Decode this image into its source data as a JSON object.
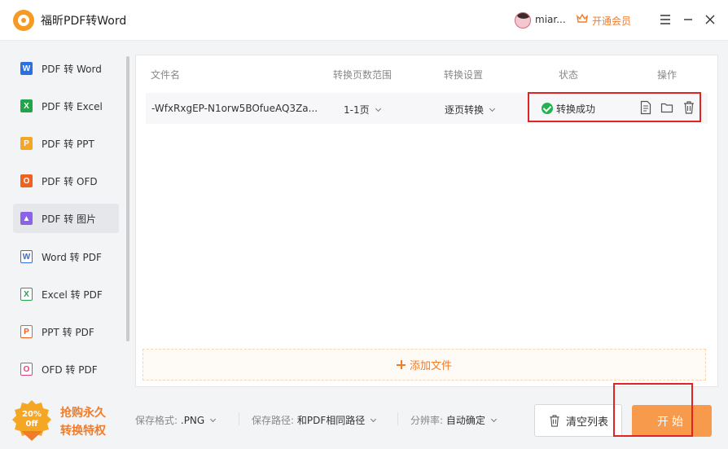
{
  "app": {
    "title": "福昕PDF转Word",
    "username": "miar...",
    "vip_label": "开通会员"
  },
  "colors": {
    "accent": "#f27b28",
    "success": "#21b34f",
    "highlight": "#e02424",
    "start_button": "#f79a4b"
  },
  "sidebar": {
    "items": [
      {
        "label": "PDF 转 Word",
        "icon": "word-icon",
        "glyph": "W",
        "color": "#2b6fe0",
        "active": false
      },
      {
        "label": "PDF 转 Excel",
        "icon": "excel-icon",
        "glyph": "X",
        "color": "#1fa64a",
        "active": false
      },
      {
        "label": "PDF 转 PPT",
        "icon": "ppt-icon",
        "glyph": "P",
        "color": "#f5a623",
        "active": false
      },
      {
        "label": "PDF 转 OFD",
        "icon": "ofd-icon",
        "glyph": "O",
        "color": "#f0611f",
        "active": false
      },
      {
        "label": "PDF 转 图片",
        "icon": "image-icon",
        "glyph": "▲",
        "color": "#8a63e8",
        "active": true
      },
      {
        "label": "Word 转 PDF",
        "icon": "word-to-pdf-icon",
        "glyph": "W",
        "color": "#2b6fe0",
        "active": false
      },
      {
        "label": "Excel 转 PDF",
        "icon": "excel-to-pdf-icon",
        "glyph": "X",
        "color": "#1fa64a",
        "active": false
      },
      {
        "label": "PPT 转 PDF",
        "icon": "ppt-to-pdf-icon",
        "glyph": "P",
        "color": "#f0611f",
        "active": false
      },
      {
        "label": "OFD 转 PDF",
        "icon": "ofd-to-pdf-icon",
        "glyph": "O",
        "color": "#e8407a",
        "active": false
      }
    ]
  },
  "table": {
    "headers": {
      "filename": "文件名",
      "page_range": "转换页数范围",
      "settings": "转换设置",
      "status": "状态",
      "actions": "操作"
    },
    "rows": [
      {
        "filename": "-WfxRxgEP-N1orw5BOfueAQ3Za...",
        "page_range": "1-1页",
        "settings": "逐页转换",
        "status": "转换成功"
      }
    ]
  },
  "add_file_label": "添加文件",
  "bottom": {
    "promo_badge_line1": "20%",
    "promo_badge_line2": "0ff",
    "promo_line1": "抢购永久",
    "promo_line2": "转换特权",
    "format_label": "保存格式:",
    "format_value": ".PNG",
    "path_label": "保存路径:",
    "path_value": "和PDF相同路径",
    "resolution_label": "分辨率:",
    "resolution_value": "自动确定",
    "clear_label": "清空列表",
    "start_label": "开始"
  }
}
